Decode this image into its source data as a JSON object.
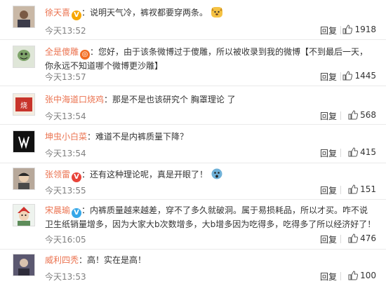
{
  "comments": [
    {
      "name": "徐天喜",
      "badge": "V",
      "text": "说明天气冷，裤衩都要穿两条。",
      "emoji": "dog-face",
      "time": "今天13:52",
      "reply": "回复",
      "likes": "1918"
    },
    {
      "name": "全是傻雕",
      "badge": "◎",
      "text": "您好，由于该条微博过于傻雕，所以被收录到我的微博【不到最后一天，你永远不知道哪个微博更沙雕】",
      "time": "今天13:57",
      "reply": "回复",
      "likes": "1445"
    },
    {
      "name": "张中海道口烧鸡",
      "badge": "",
      "text": "那是不是也该研究个 胸罩理论 了",
      "time": "今天13:54",
      "reply": "回复",
      "likes": "568"
    },
    {
      "name": "坤虫小白菜",
      "badge": "",
      "text": "难道不是内裤质量下降？",
      "time": "今天13:54",
      "reply": "回复",
      "likes": "415"
    },
    {
      "name": "张领雷",
      "badge": "V",
      "text": "还有这种理论呢，真是开眼了！",
      "emoji": "surprised-face",
      "time": "今天13:55",
      "reply": "回复",
      "likes": "151"
    },
    {
      "name": "宋晨瑜",
      "badge": "V",
      "text": "内裤质量越来越差，穿不了多久就破洞。属于易损耗品，所以才买。咋不说卫生纸销量增多，因为大家大b次数增多，大b增多因为吃得多，吃得多了所以经济好了！",
      "time": "今天16:05",
      "reply": "回复",
      "likes": "476"
    },
    {
      "name": "威利四秃",
      "badge": "",
      "text": "高！实在是高！",
      "time": "今天13:53",
      "reply": "回复",
      "likes": "100"
    }
  ]
}
